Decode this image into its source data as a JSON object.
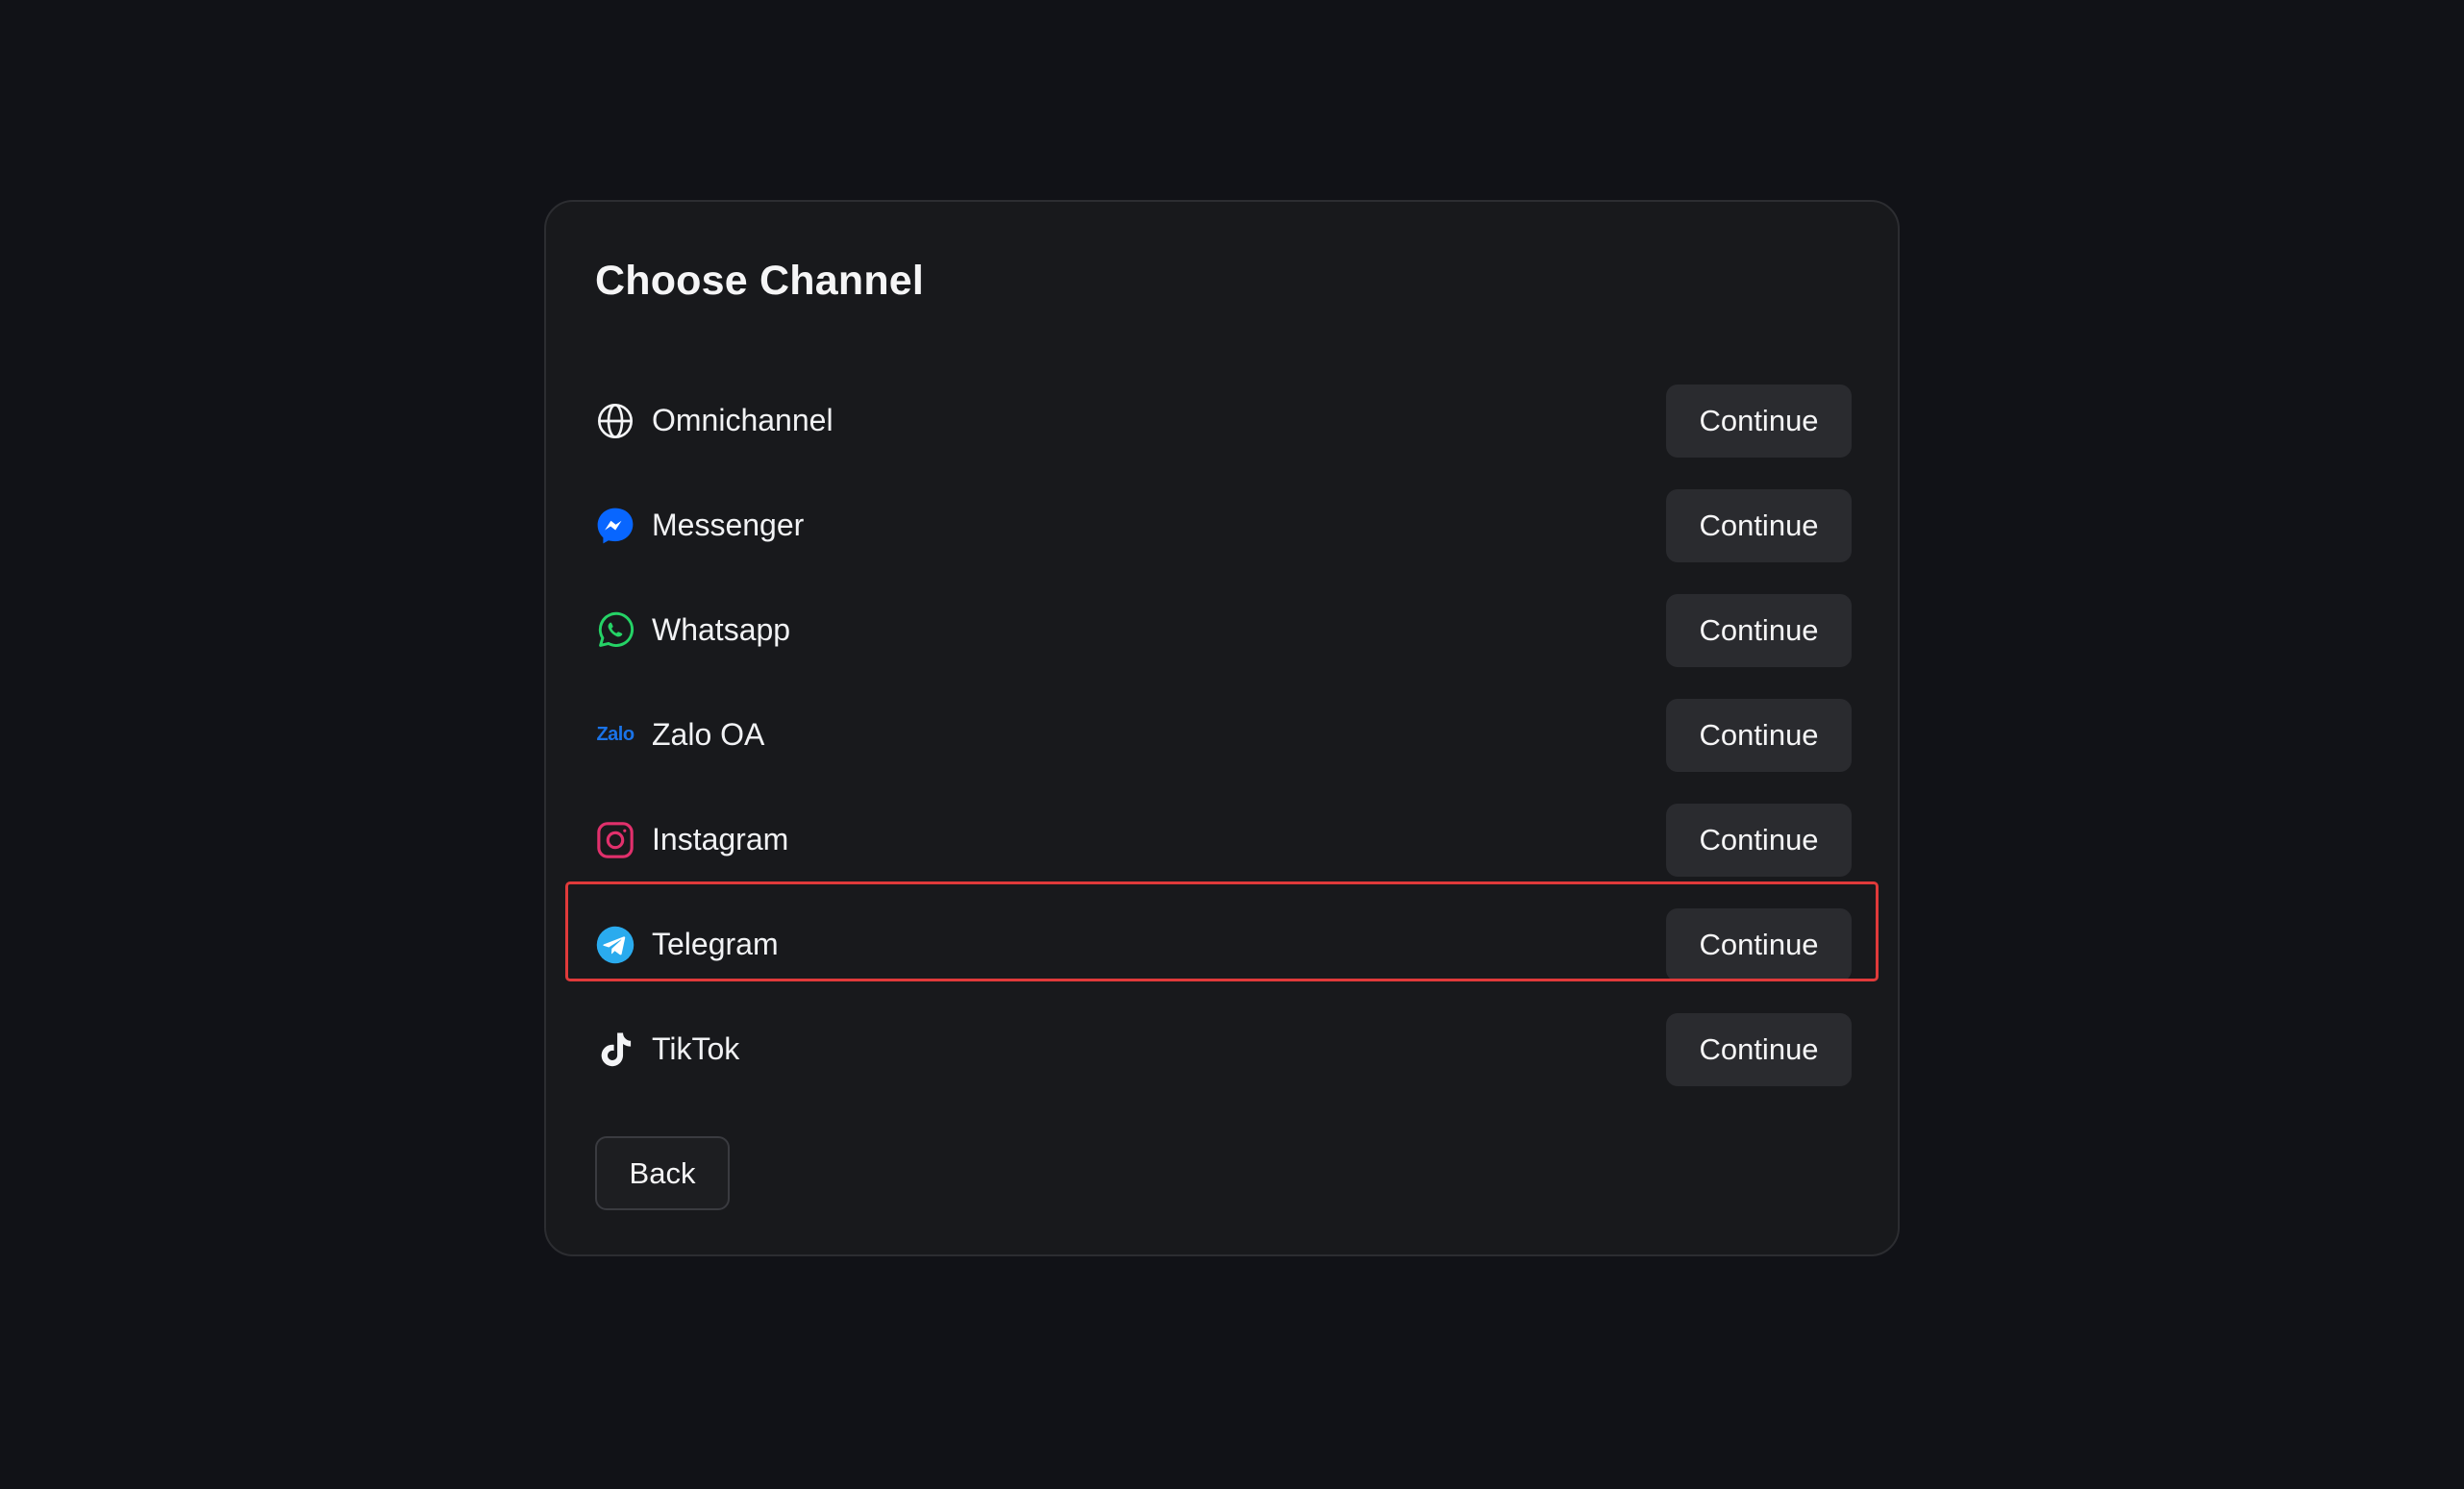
{
  "dialog": {
    "title": "Choose Channel",
    "back_label": "Back",
    "highlight_color": "#e03a3a"
  },
  "channels": [
    {
      "label": "Omnichannel",
      "icon": "globe-icon",
      "button": "Continue"
    },
    {
      "label": "Messenger",
      "icon": "messenger-icon",
      "button": "Continue",
      "color": "#0866ff"
    },
    {
      "label": "Whatsapp",
      "icon": "whatsapp-icon",
      "button": "Continue",
      "color": "#25d366"
    },
    {
      "label": "Zalo OA",
      "icon": "zalo-icon",
      "icon_text": "Zalo",
      "button": "Continue",
      "color": "#1a73e8"
    },
    {
      "label": "Instagram",
      "icon": "instagram-icon",
      "button": "Continue",
      "color": "#e1306c"
    },
    {
      "label": "Telegram",
      "icon": "telegram-icon",
      "button": "Continue",
      "color": "#2aabee"
    },
    {
      "label": "TikTok",
      "icon": "tiktok-icon",
      "button": "Continue"
    }
  ]
}
